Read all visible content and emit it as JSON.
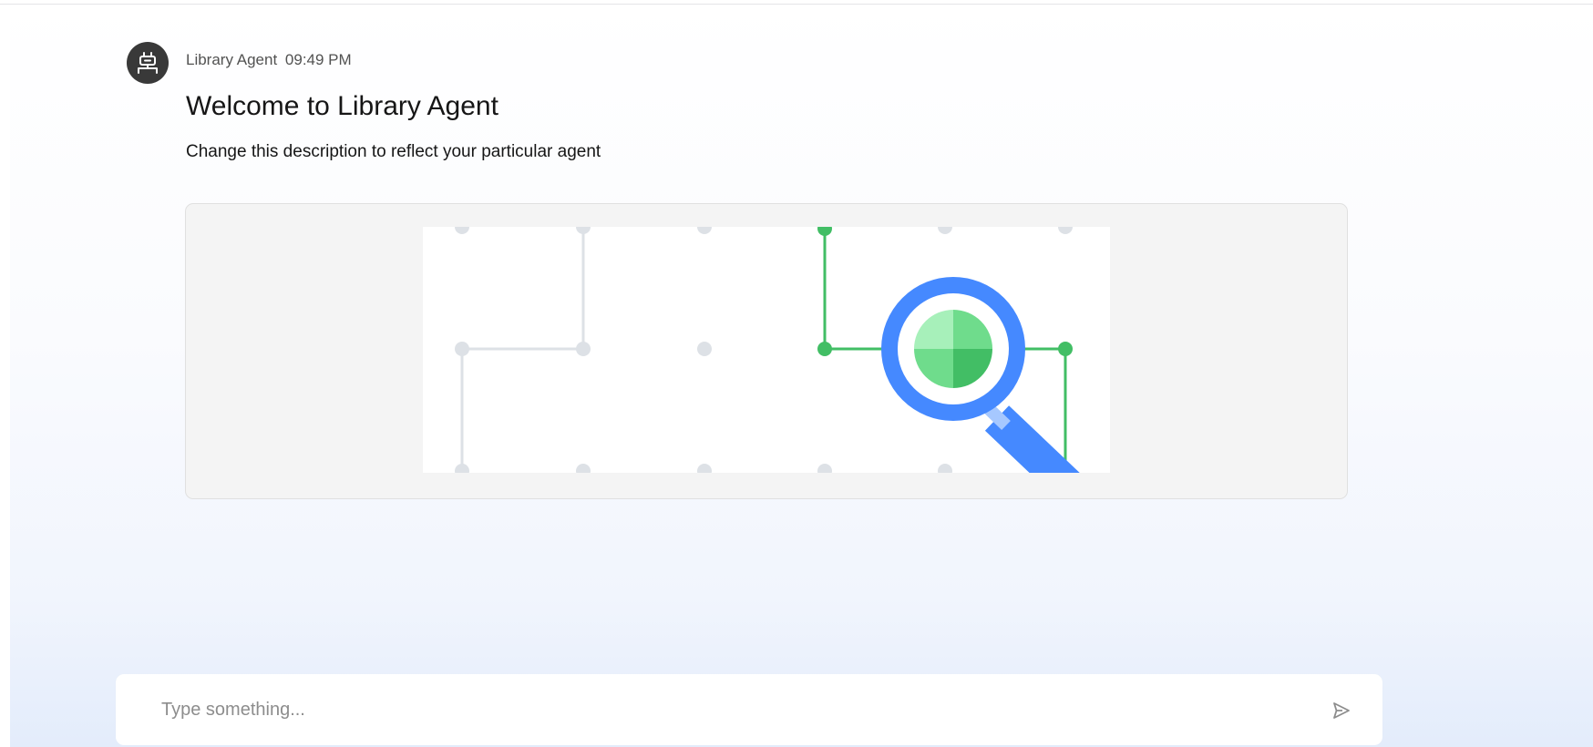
{
  "message": {
    "sender": "Library Agent",
    "time": "09:49 PM",
    "title": "Welcome to Library Agent",
    "description": "Change this description to reflect your particular agent",
    "avatar_icon": "robot-icon",
    "illustration_icon": "magnifier-graph-illustration"
  },
  "composer": {
    "placeholder": "Type something...",
    "value": "",
    "send_icon": "send-icon"
  },
  "colors": {
    "avatar_bg": "#393939",
    "accent_green": "#42be65",
    "accent_blue": "#4589ff",
    "grid_gray": "#dde1e6",
    "card_bg": "#f4f4f4"
  }
}
